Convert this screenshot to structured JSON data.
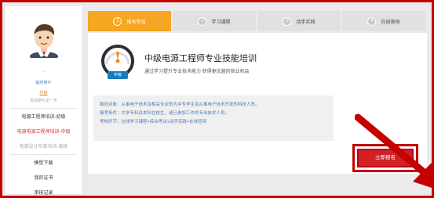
{
  "sidebar": {
    "dot": "•",
    "username": "临时用户",
    "level_link": "升级",
    "note": "有效期不足一天",
    "items": [
      {
        "label": "电源工程师培训-初级",
        "state": "normal"
      },
      {
        "label": "电源电源工程师培训-中级",
        "state": "active"
      },
      {
        "label": "电源设计专家培训-高级",
        "state": "muted"
      },
      {
        "label": "模型下载",
        "state": "normal"
      },
      {
        "label": "我的证书",
        "state": "normal"
      },
      {
        "label": "审核记录",
        "state": "normal"
      }
    ]
  },
  "steps": [
    {
      "num": "1",
      "label": "报名参加",
      "active": true
    },
    {
      "num": "2",
      "label": "学习课程",
      "active": false
    },
    {
      "num": "3",
      "label": "动手实践",
      "active": false
    },
    {
      "num": "4",
      "label": "在线答辩",
      "active": false
    }
  ],
  "course": {
    "badge": "中级",
    "title": "中级电源工程师专业技能培训",
    "subtitle": "通过学习提升专业技术能力 获得更优越的就业机会"
  },
  "info": {
    "lines": [
      "面向对象：从事电子技术及相关专业的大中专学生及从事电子技术开发的科技人员。",
      "报考条件：大学专科及本科在校生，或已参加工作的专业技术人员。",
      "考核环节：在线学习课程+综合考试+动手实践+在线答辩"
    ]
  },
  "actions": {
    "signup_label": "立即报名"
  },
  "colors": {
    "accent": "#f5a623",
    "primary_button": "#d32025",
    "frame": "#c40000"
  },
  "icons": [
    "avatar-icon",
    "gauge-icon",
    "red-arrow-icon"
  ]
}
